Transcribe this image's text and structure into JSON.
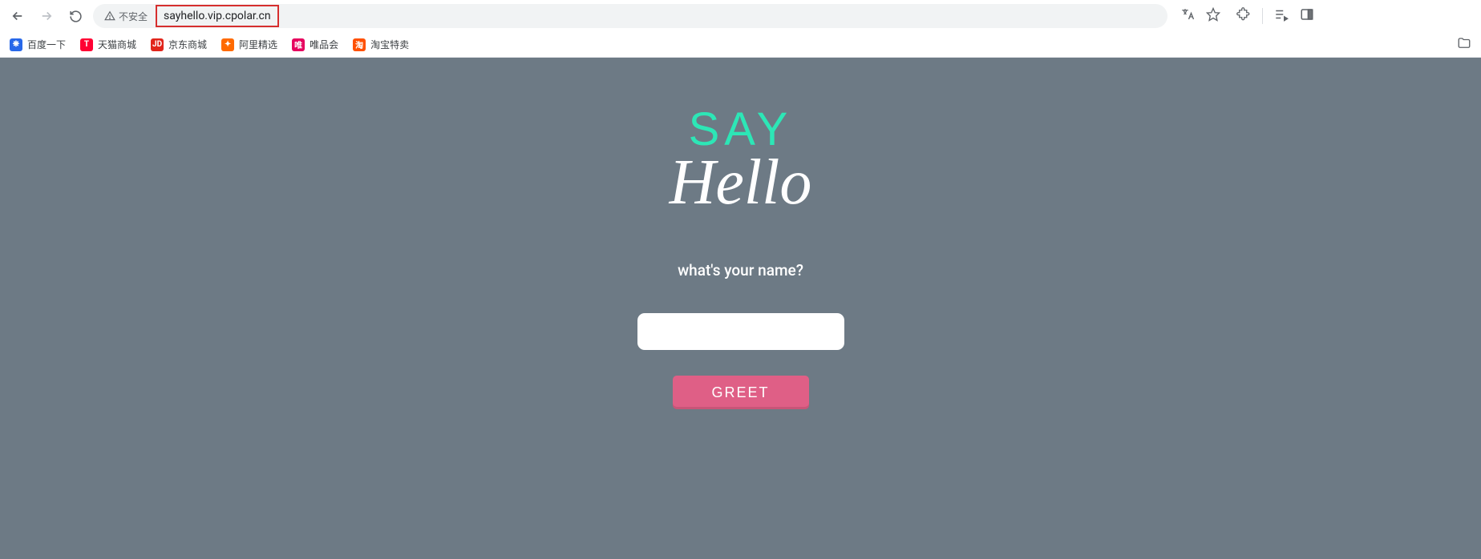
{
  "browser": {
    "security_text": "不安全",
    "url": "sayhello.vip.cpolar.cn"
  },
  "bookmarks": [
    {
      "label": "百度一下",
      "color": "#2868e9",
      "icon": "❋"
    },
    {
      "label": "天猫商城",
      "color": "#ff0033",
      "icon": "T"
    },
    {
      "label": "京东商城",
      "color": "#e1251b",
      "icon": "JD"
    },
    {
      "label": "阿里精选",
      "color": "#ff6a00",
      "icon": "✦"
    },
    {
      "label": "唯品会",
      "color": "#e6005e",
      "icon": "唯"
    },
    {
      "label": "淘宝特卖",
      "color": "#ff5000",
      "icon": "淘"
    }
  ],
  "page": {
    "title_line1": "SAY",
    "title_line2": "Hello",
    "prompt": "what's your name?",
    "input_value": "",
    "button_label": "GREET"
  }
}
